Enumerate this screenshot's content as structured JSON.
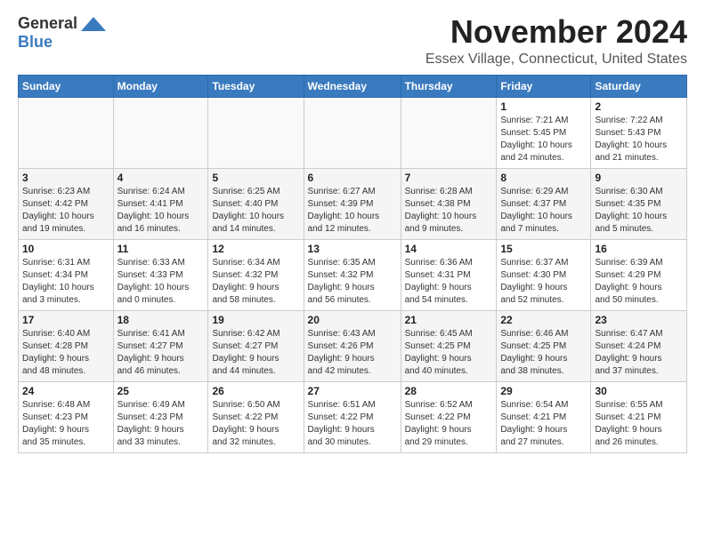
{
  "header": {
    "logo_general": "General",
    "logo_blue": "Blue",
    "month_title": "November 2024",
    "location": "Essex Village, Connecticut, United States"
  },
  "calendar": {
    "days_of_week": [
      "Sunday",
      "Monday",
      "Tuesday",
      "Wednesday",
      "Thursday",
      "Friday",
      "Saturday"
    ],
    "weeks": [
      [
        {
          "day": "",
          "info": ""
        },
        {
          "day": "",
          "info": ""
        },
        {
          "day": "",
          "info": ""
        },
        {
          "day": "",
          "info": ""
        },
        {
          "day": "",
          "info": ""
        },
        {
          "day": "1",
          "info": "Sunrise: 7:21 AM\nSunset: 5:45 PM\nDaylight: 10 hours\nand 24 minutes."
        },
        {
          "day": "2",
          "info": "Sunrise: 7:22 AM\nSunset: 5:43 PM\nDaylight: 10 hours\nand 21 minutes."
        }
      ],
      [
        {
          "day": "3",
          "info": "Sunrise: 6:23 AM\nSunset: 4:42 PM\nDaylight: 10 hours\nand 19 minutes."
        },
        {
          "day": "4",
          "info": "Sunrise: 6:24 AM\nSunset: 4:41 PM\nDaylight: 10 hours\nand 16 minutes."
        },
        {
          "day": "5",
          "info": "Sunrise: 6:25 AM\nSunset: 4:40 PM\nDaylight: 10 hours\nand 14 minutes."
        },
        {
          "day": "6",
          "info": "Sunrise: 6:27 AM\nSunset: 4:39 PM\nDaylight: 10 hours\nand 12 minutes."
        },
        {
          "day": "7",
          "info": "Sunrise: 6:28 AM\nSunset: 4:38 PM\nDaylight: 10 hours\nand 9 minutes."
        },
        {
          "day": "8",
          "info": "Sunrise: 6:29 AM\nSunset: 4:37 PM\nDaylight: 10 hours\nand 7 minutes."
        },
        {
          "day": "9",
          "info": "Sunrise: 6:30 AM\nSunset: 4:35 PM\nDaylight: 10 hours\nand 5 minutes."
        }
      ],
      [
        {
          "day": "10",
          "info": "Sunrise: 6:31 AM\nSunset: 4:34 PM\nDaylight: 10 hours\nand 3 minutes."
        },
        {
          "day": "11",
          "info": "Sunrise: 6:33 AM\nSunset: 4:33 PM\nDaylight: 10 hours\nand 0 minutes."
        },
        {
          "day": "12",
          "info": "Sunrise: 6:34 AM\nSunset: 4:32 PM\nDaylight: 9 hours\nand 58 minutes."
        },
        {
          "day": "13",
          "info": "Sunrise: 6:35 AM\nSunset: 4:32 PM\nDaylight: 9 hours\nand 56 minutes."
        },
        {
          "day": "14",
          "info": "Sunrise: 6:36 AM\nSunset: 4:31 PM\nDaylight: 9 hours\nand 54 minutes."
        },
        {
          "day": "15",
          "info": "Sunrise: 6:37 AM\nSunset: 4:30 PM\nDaylight: 9 hours\nand 52 minutes."
        },
        {
          "day": "16",
          "info": "Sunrise: 6:39 AM\nSunset: 4:29 PM\nDaylight: 9 hours\nand 50 minutes."
        }
      ],
      [
        {
          "day": "17",
          "info": "Sunrise: 6:40 AM\nSunset: 4:28 PM\nDaylight: 9 hours\nand 48 minutes."
        },
        {
          "day": "18",
          "info": "Sunrise: 6:41 AM\nSunset: 4:27 PM\nDaylight: 9 hours\nand 46 minutes."
        },
        {
          "day": "19",
          "info": "Sunrise: 6:42 AM\nSunset: 4:27 PM\nDaylight: 9 hours\nand 44 minutes."
        },
        {
          "day": "20",
          "info": "Sunrise: 6:43 AM\nSunset: 4:26 PM\nDaylight: 9 hours\nand 42 minutes."
        },
        {
          "day": "21",
          "info": "Sunrise: 6:45 AM\nSunset: 4:25 PM\nDaylight: 9 hours\nand 40 minutes."
        },
        {
          "day": "22",
          "info": "Sunrise: 6:46 AM\nSunset: 4:25 PM\nDaylight: 9 hours\nand 38 minutes."
        },
        {
          "day": "23",
          "info": "Sunrise: 6:47 AM\nSunset: 4:24 PM\nDaylight: 9 hours\nand 37 minutes."
        }
      ],
      [
        {
          "day": "24",
          "info": "Sunrise: 6:48 AM\nSunset: 4:23 PM\nDaylight: 9 hours\nand 35 minutes."
        },
        {
          "day": "25",
          "info": "Sunrise: 6:49 AM\nSunset: 4:23 PM\nDaylight: 9 hours\nand 33 minutes."
        },
        {
          "day": "26",
          "info": "Sunrise: 6:50 AM\nSunset: 4:22 PM\nDaylight: 9 hours\nand 32 minutes."
        },
        {
          "day": "27",
          "info": "Sunrise: 6:51 AM\nSunset: 4:22 PM\nDaylight: 9 hours\nand 30 minutes."
        },
        {
          "day": "28",
          "info": "Sunrise: 6:52 AM\nSunset: 4:22 PM\nDaylight: 9 hours\nand 29 minutes."
        },
        {
          "day": "29",
          "info": "Sunrise: 6:54 AM\nSunset: 4:21 PM\nDaylight: 9 hours\nand 27 minutes."
        },
        {
          "day": "30",
          "info": "Sunrise: 6:55 AM\nSunset: 4:21 PM\nDaylight: 9 hours\nand 26 minutes."
        }
      ]
    ]
  }
}
